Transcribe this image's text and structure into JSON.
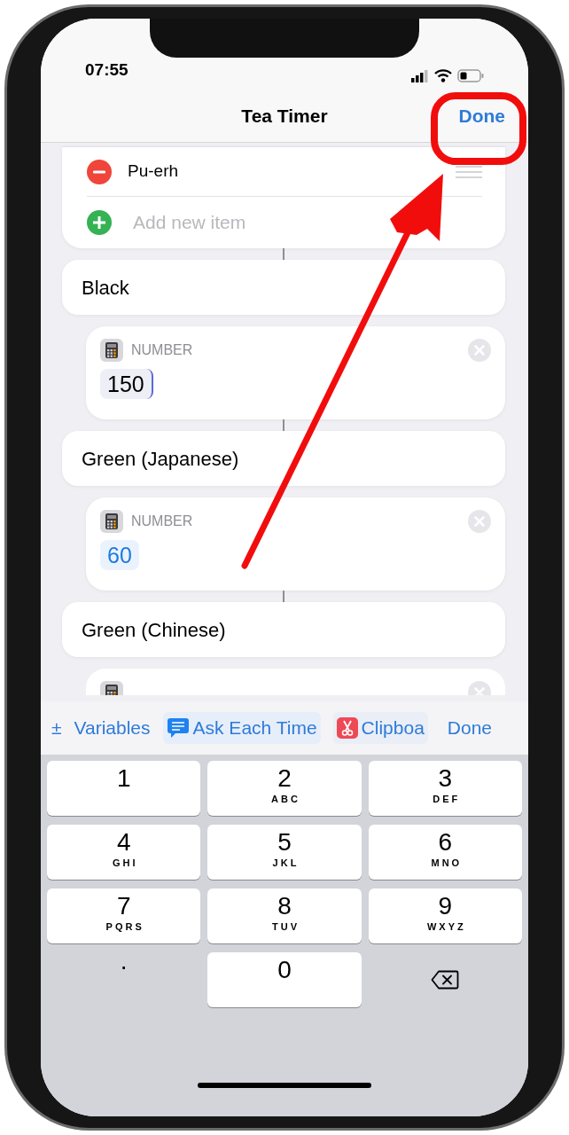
{
  "status_bar": {
    "time": "07:55"
  },
  "nav": {
    "title": "Tea Timer",
    "done": "Done"
  },
  "list": [
    {
      "kind": "item",
      "label": "Pu-erh"
    },
    {
      "kind": "add",
      "placeholder": "Add new item"
    }
  ],
  "sections": [
    {
      "title": "Black",
      "number": {
        "label": "NUMBER",
        "value": "150",
        "focused": true
      }
    },
    {
      "title": "Green (Japanese)",
      "number": {
        "label": "NUMBER",
        "value": "60",
        "focused": false
      }
    },
    {
      "title": "Green (Chinese)"
    }
  ],
  "toolbar": [
    {
      "kind": "plain",
      "label": "±"
    },
    {
      "kind": "plain",
      "label": "Variables"
    },
    {
      "kind": "ask",
      "label": "Ask Each Time"
    },
    {
      "kind": "clipboard",
      "label": "Clipboa"
    },
    {
      "kind": "done",
      "label": "Done"
    }
  ],
  "keys": [
    {
      "kind": "digit",
      "digit": "1"
    },
    {
      "kind": "digit",
      "digit": "2",
      "letters": "ABC"
    },
    {
      "kind": "digit",
      "digit": "3",
      "letters": "DEF"
    },
    {
      "kind": "digit",
      "digit": "4",
      "letters": "GHI"
    },
    {
      "kind": "digit",
      "digit": "5",
      "letters": "JKL"
    },
    {
      "kind": "digit",
      "digit": "6",
      "letters": "MNO"
    },
    {
      "kind": "digit",
      "digit": "7",
      "letters": "PQRS"
    },
    {
      "kind": "digit",
      "digit": "8",
      "letters": "TUV"
    },
    {
      "kind": "digit",
      "digit": "9",
      "letters": "WXYZ"
    },
    {
      "kind": "symbol",
      "digit": "."
    },
    {
      "kind": "digit",
      "digit": "0"
    },
    {
      "kind": "delete"
    }
  ]
}
